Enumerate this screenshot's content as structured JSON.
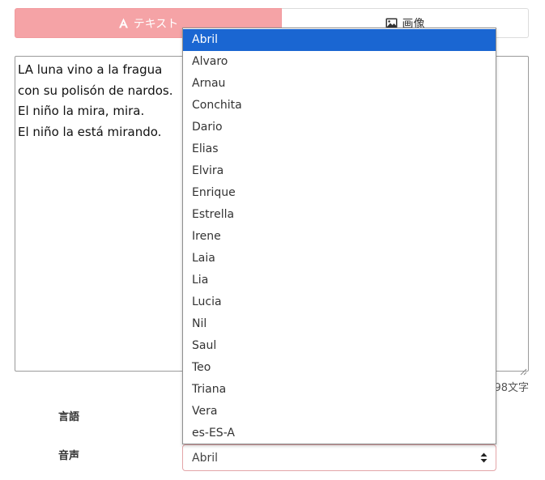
{
  "tabs": {
    "text_label": "テキスト",
    "image_label": "画像"
  },
  "editor": {
    "lines": [
      "LA luna vino a la fragua",
      "con su polisón de nardos.",
      "El niño la mira, mira.",
      "El niño la está mirando."
    ]
  },
  "char_count": "98文字",
  "form": {
    "language_label": "言語",
    "voice_label": "音声",
    "voice_selected": "Abril"
  },
  "voice_options": [
    "Abril",
    "Alvaro",
    "Arnau",
    "Conchita",
    "Dario",
    "Elias",
    "Elvira",
    "Enrique",
    "Estrella",
    "Irene",
    "Laia",
    "Lia",
    "Lucia",
    "Nil",
    "Saul",
    "Teo",
    "Triana",
    "Vera",
    "es-ES-A"
  ],
  "colors": {
    "accent_tab": "#f5a3a6",
    "highlight": "#1a66d2"
  }
}
